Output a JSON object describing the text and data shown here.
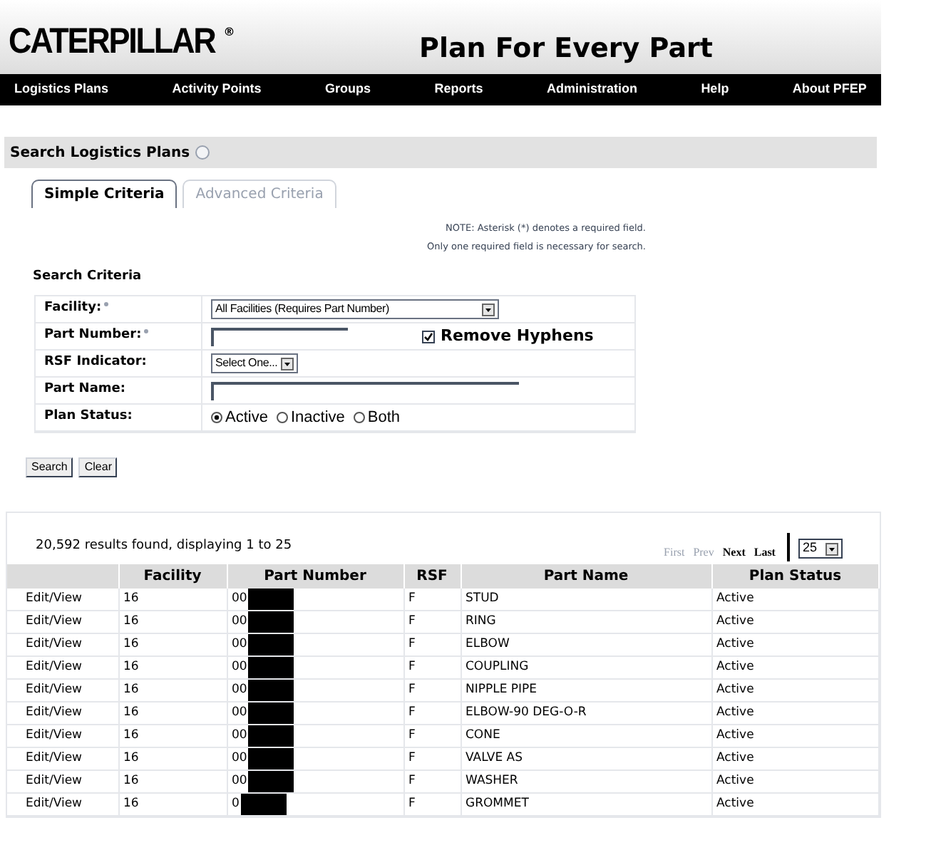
{
  "header": {
    "logo": "CATERPILLAR",
    "logo_mark": "®",
    "title": "Plan For Every Part"
  },
  "nav": [
    "Logistics Plans",
    "Activity Points",
    "Groups",
    "Reports",
    "Administration",
    "Help",
    "About PFEP"
  ],
  "section_title": "Search Logistics Plans",
  "tabs": [
    {
      "label": "Simple Criteria",
      "selected": true,
      "disabled": false
    },
    {
      "label": "Advanced Criteria",
      "selected": false,
      "disabled": true
    }
  ],
  "notes": [
    "NOTE: Asterisk (*) denotes a required field.",
    "Only one required field is necessary for search."
  ],
  "criteria_title": "Search Criteria",
  "form": [
    {
      "kind": "select",
      "label": "Facility:",
      "required": true,
      "value": "All Facilities (Requires Part Number)"
    },
    {
      "kind": "text",
      "label": "Part Number:",
      "required": true,
      "checkbox": {
        "label": "Remove Hyphens",
        "checked": true
      }
    },
    {
      "kind": "select_small",
      "label": "RSF Indicator:",
      "required": false,
      "value": "Select One..."
    },
    {
      "kind": "text_wide",
      "label": "Part Name:",
      "required": false
    },
    {
      "kind": "radio",
      "label": "Plan Status:",
      "required": false,
      "options": [
        {
          "label": "Active",
          "selected": true
        },
        {
          "label": "Inactive",
          "selected": false
        },
        {
          "label": "Both",
          "selected": false
        }
      ]
    }
  ],
  "buttons": [
    "Search",
    "Clear"
  ],
  "results": {
    "summary": "20,592 results found, displaying 1 to 25",
    "pager": [
      {
        "label": "First",
        "disabled": true
      },
      {
        "label": "Prev",
        "disabled": true
      },
      {
        "label": "Next",
        "disabled": false
      },
      {
        "label": "Last",
        "disabled": false
      }
    ],
    "page_size": "25",
    "columns": [
      "",
      "Facility",
      "Part Number",
      "RSF",
      "Part Name",
      "Plan Status"
    ],
    "rows": [
      [
        "Edit/View",
        "16",
        "00",
        "F",
        "STUD",
        "Active"
      ],
      [
        "Edit/View",
        "16",
        "00",
        "F",
        "RING",
        "Active"
      ],
      [
        "Edit/View",
        "16",
        "00",
        "F",
        "ELBOW",
        "Active"
      ],
      [
        "Edit/View",
        "16",
        "00",
        "F",
        "COUPLING",
        "Active"
      ],
      [
        "Edit/View",
        "16",
        "00",
        "F",
        "NIPPLE PIPE",
        "Active"
      ],
      [
        "Edit/View",
        "16",
        "00",
        "F",
        "ELBOW-90 DEG-O-R",
        "Active"
      ],
      [
        "Edit/View",
        "16",
        "00",
        "F",
        "CONE",
        "Active"
      ],
      [
        "Edit/View",
        "16",
        "00",
        "F",
        "VALVE AS",
        "Active"
      ],
      [
        "Edit/View",
        "16",
        "00",
        "F",
        "WASHER",
        "Active"
      ],
      [
        "Edit/View",
        "16",
        "0",
        "F",
        "GROMMET",
        "Active"
      ]
    ]
  }
}
